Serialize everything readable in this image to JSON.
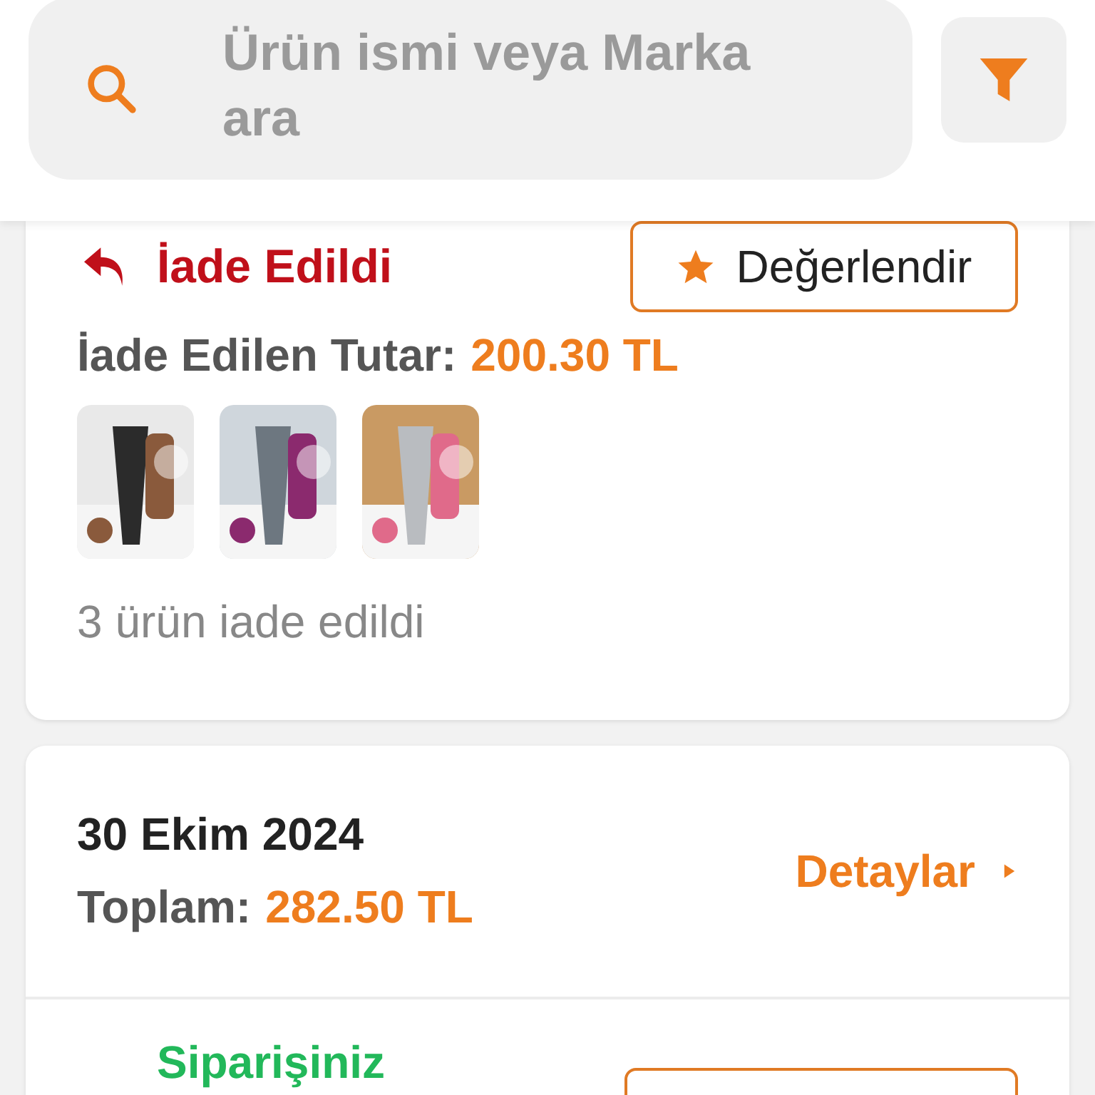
{
  "search": {
    "placeholder": "Ürün ismi veya Marka ara"
  },
  "orders": [
    {
      "kind": "returned",
      "status": "İade Edildi",
      "rate_button": "Değerlendir",
      "amount_label": "İade Edilen Tutar:",
      "amount": "200.30 TL",
      "note": "3 ürün iade edildi"
    },
    {
      "kind": "summary",
      "date": "30 Ekim 2024",
      "total_label": "Toplam:",
      "total": "282.50 TL",
      "details": "Detaylar",
      "status": "Siparişiniz"
    }
  ]
}
